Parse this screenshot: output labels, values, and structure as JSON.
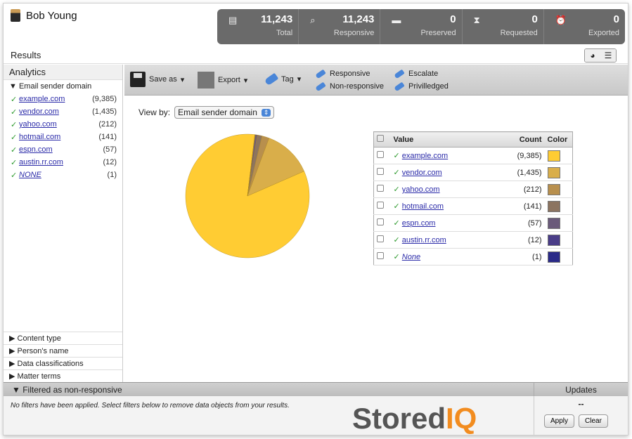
{
  "user": {
    "name": "Bob Young"
  },
  "stats": [
    {
      "icon": "database-icon",
      "glyph": "▤",
      "value": "11,243",
      "label": "Total"
    },
    {
      "icon": "search-icon",
      "glyph": "⌕",
      "value": "11,243",
      "label": "Responsive"
    },
    {
      "icon": "disk-icon",
      "glyph": "▬",
      "value": "0",
      "label": "Preserved"
    },
    {
      "icon": "hourglass-icon",
      "glyph": "⧗",
      "value": "0",
      "label": "Requested"
    },
    {
      "icon": "alarm-icon",
      "glyph": "⏰",
      "value": "0",
      "label": "Exported"
    }
  ],
  "results_label": "Results",
  "sidebar": {
    "analytics_label": "Analytics",
    "facet_title": "Email sender domain",
    "items": [
      {
        "label": "example.com",
        "count": "(9,385)"
      },
      {
        "label": "vendor.com",
        "count": "(1,435)"
      },
      {
        "label": "yahoo.com",
        "count": "(212)"
      },
      {
        "label": "hotmail.com",
        "count": "(141)"
      },
      {
        "label": "espn.com",
        "count": "(57)"
      },
      {
        "label": "austin.rr.com",
        "count": "(12)"
      },
      {
        "label": "NONE",
        "count": "(1)"
      }
    ],
    "collapsed": [
      "Content type",
      "Person's name",
      "Data classifications",
      "Matter terms"
    ]
  },
  "toolbar": {
    "save_as": "Save as",
    "export": "Export",
    "tag": "Tag",
    "responsive": "Responsive",
    "non_responsive": "Non-responsive",
    "escalate": "Escalate",
    "privileged": "Privilledged"
  },
  "view_by": {
    "label": "View by:",
    "value": "Email sender domain"
  },
  "table": {
    "headers": {
      "value": "Value",
      "count": "Count",
      "color": "Color"
    },
    "rows": [
      {
        "value": "example.com",
        "count": "(9,385)",
        "color": "#FFCC33"
      },
      {
        "value": "vendor.com",
        "count": "(1,435)",
        "color": "#D9AE4A"
      },
      {
        "value": "yahoo.com",
        "count": "(212)",
        "color": "#B88F4D"
      },
      {
        "value": "hotmail.com",
        "count": "(141)",
        "color": "#8C7460"
      },
      {
        "value": "espn.com",
        "count": "(57)",
        "color": "#6A5A7A"
      },
      {
        "value": "austin.rr.com",
        "count": "(12)",
        "color": "#4A3D88"
      },
      {
        "value": "None",
        "count": "(1)",
        "color": "#2A2A88"
      }
    ]
  },
  "chart_data": {
    "type": "pie",
    "categories": [
      "example.com",
      "vendor.com",
      "yahoo.com",
      "hotmail.com",
      "espn.com",
      "austin.rr.com",
      "None"
    ],
    "values": [
      9385,
      1435,
      212,
      141,
      57,
      12,
      1
    ],
    "colors": [
      "#FFCC33",
      "#D9AE4A",
      "#B88F4D",
      "#8C7460",
      "#6A5A7A",
      "#4A3D88",
      "#2A2A88"
    ]
  },
  "bottom": {
    "filter_title": "Filtered as non-responsive",
    "note": "No filters have been applied. Select filters below to remove data objects from your results.",
    "brand_main": "Stored",
    "brand_accent": "IQ",
    "updates_label": "Updates",
    "updates_value": "--",
    "apply": "Apply",
    "clear": "Clear"
  }
}
